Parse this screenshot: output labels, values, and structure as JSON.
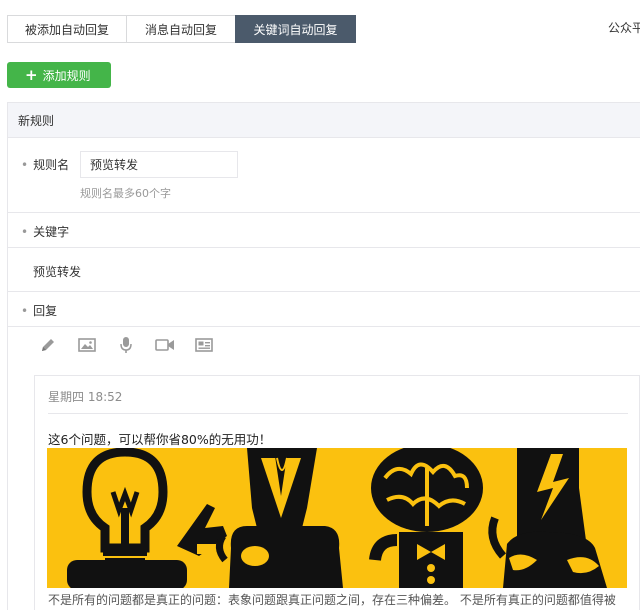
{
  "tabs": [
    {
      "label": "被添加自动回复"
    },
    {
      "label": "消息自动回复"
    },
    {
      "label": "关键词自动回复",
      "active": true
    }
  ],
  "header_right": "公众平",
  "add_button": {
    "label": "添加规则",
    "color": "#44b549"
  },
  "rule": {
    "header": "新规则",
    "name_label": "规则名",
    "name_value": "预览转发",
    "name_hint": "规则名最多60个字",
    "keyword_label": "关键字",
    "keyword_value": "预览转发",
    "reply_label": "回复",
    "reply_tools": [
      "pencil-icon",
      "image-icon",
      "microphone-icon",
      "video-icon",
      "news-icon"
    ]
  },
  "preview": {
    "time": "星期四 18:52",
    "title": "这6个问题，可以帮你省80%的无用功！",
    "desc": "不是所有的问题都是真正的问题：表象问题跟真正问题之间，存在三种偏差。 不是所有真正的问题都值得被",
    "cover_color": "#fbc10f"
  },
  "colors": {
    "active_tab": "#4b5a6b",
    "panel_header": "#f4f5f9"
  }
}
